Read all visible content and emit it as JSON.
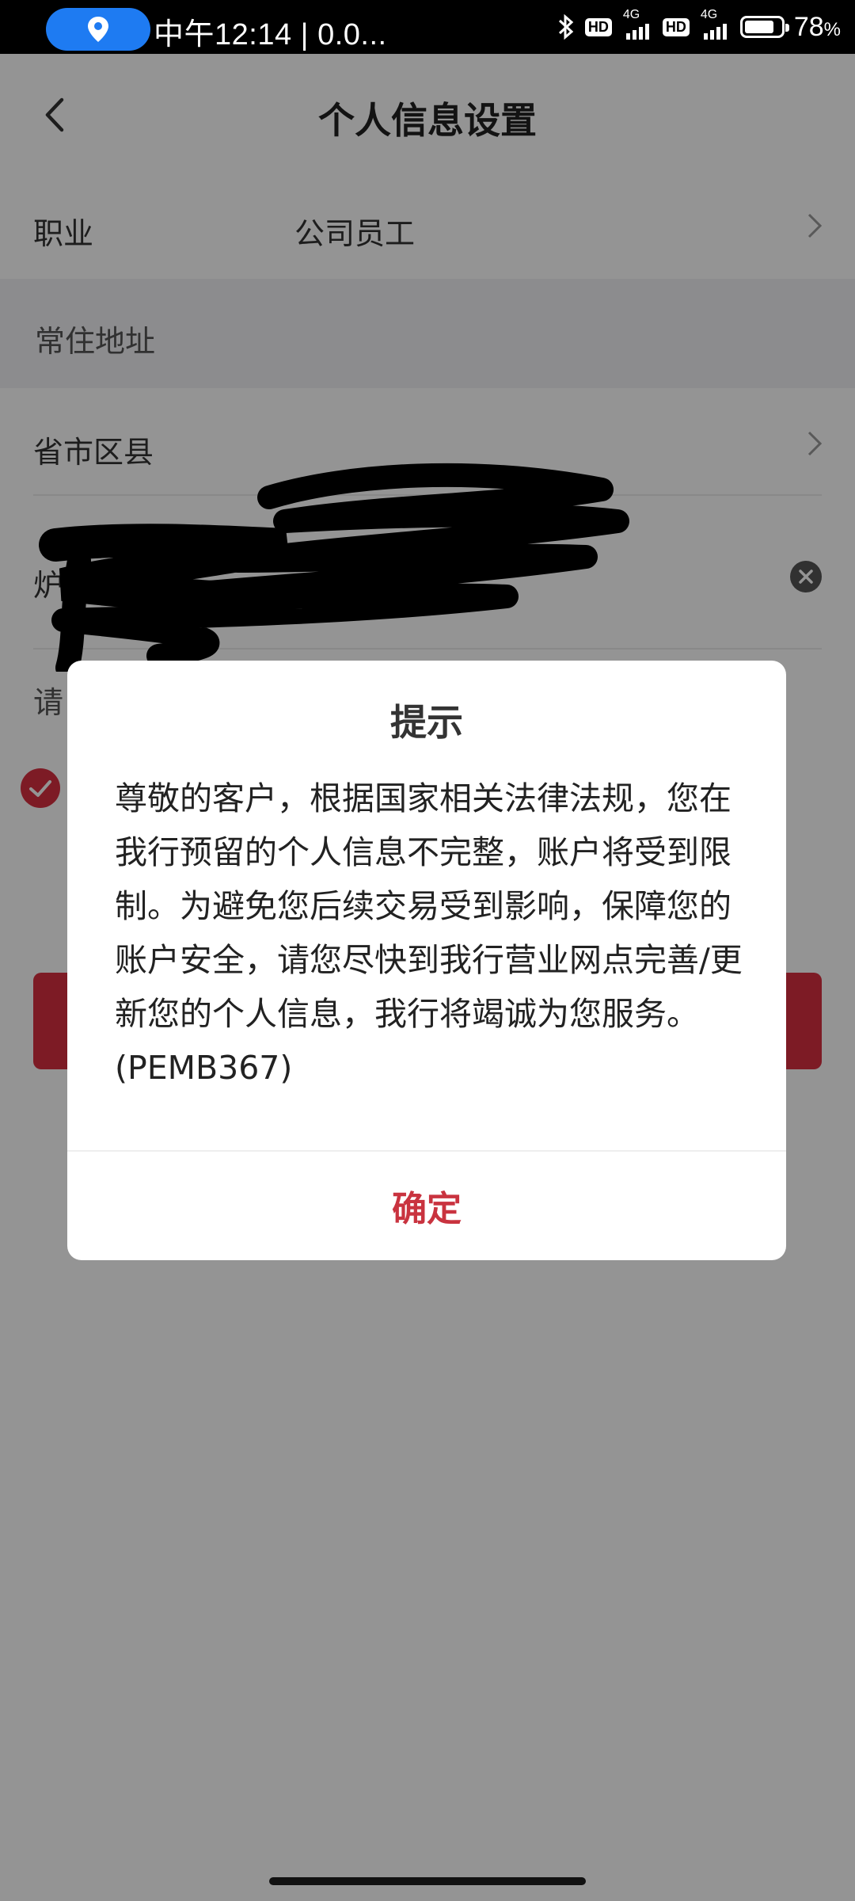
{
  "status_bar": {
    "time_text": "中午12:14 | 0.0...",
    "battery_percent": "78",
    "battery_unit": "%",
    "network_labels": [
      "HD",
      "4G",
      "HD",
      "4G"
    ],
    "icons": [
      "location-icon",
      "bluetooth-icon",
      "battery-icon"
    ]
  },
  "header": {
    "title": "个人信息设置",
    "back_icon": "chevron-left-icon"
  },
  "form": {
    "occupation_label": "职业",
    "occupation_value": "公司员工",
    "address_section": "常住地址",
    "region_label": "省市区县",
    "detail_label_partial": "炉",
    "hint_partial": "请",
    "hint_tail": "。"
  },
  "dialog": {
    "title": "提示",
    "message": "尊敬的客户，根据国家相关法律法规，您在我行预留的个人信息不完整，账户将受到限制。为避免您后续交易受到影响，保障您的账户安全，请您尽快到我行营业网点完善/更新您的个人信息，我行将竭诚为您服务。(PEMB367)",
    "confirm_label": "确定"
  },
  "colors": {
    "accent_red": "#d83040",
    "confirm_text": "#c9333f",
    "location_pill": "#1e7bf2"
  }
}
